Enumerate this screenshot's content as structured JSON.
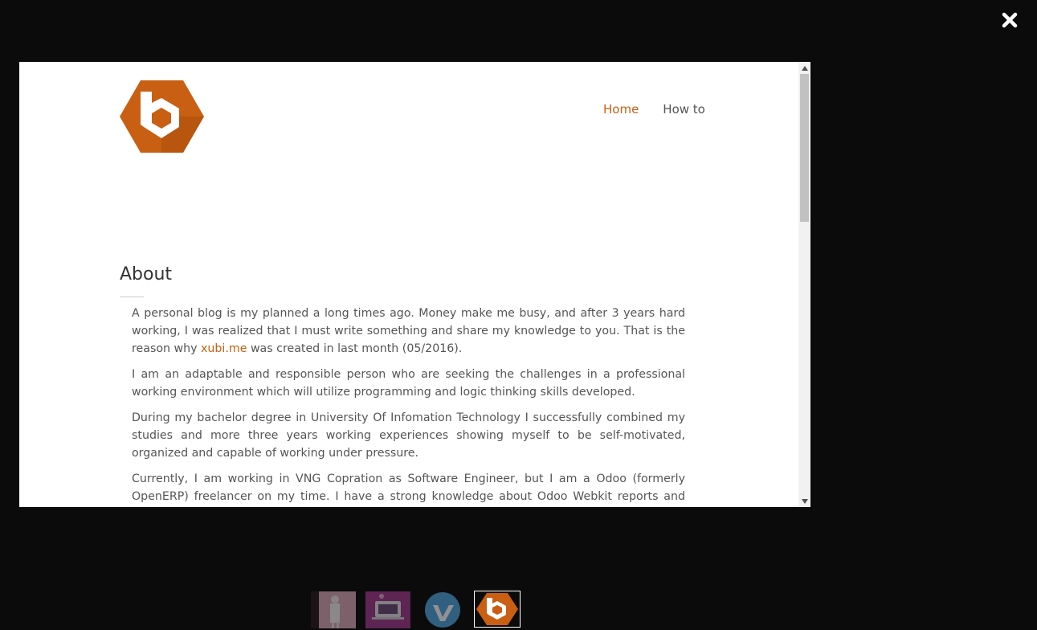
{
  "close": {
    "icon": "close-icon"
  },
  "site": {
    "logo": {
      "icon": "hexagon-b-logo-icon",
      "brand_color": "#c95f12"
    },
    "nav": [
      {
        "label": "Home",
        "active": true
      },
      {
        "label": "How to",
        "active": false
      }
    ]
  },
  "about": {
    "title": "About",
    "p1_before": "A personal blog is my planned a long times ago. Money make me busy, and after 3 years hard working, I was realized that I must write something and share my knowledge to you. That is the reason why ",
    "p1_link": "xubi.me",
    "p1_after": " was created in last month (05/2016).",
    "p2": "I am an adaptable and responsible person who are seeking the challenges in a professional working environment which will utilize programming and logic thinking skills developed.",
    "p3": "During my bachelor degree in University Of Infomation Technology I successfully combined my studies and more three years working experiences showing myself to be self-motivated, organized and capable of working under pressure.",
    "p4": "Currently, I am working in VNG Copration as Software Engineer, but I am a Odoo (formerly OpenERP) freelancer on my time. I have a strong knowledge about Odoo Webkit reports and POS module."
  },
  "thumbnails": [
    {
      "icon": "person-photo-thumbnail",
      "active": false
    },
    {
      "icon": "laptop-photo-thumbnail",
      "active": false
    },
    {
      "icon": "vimeo-logo-thumbnail",
      "active": false
    },
    {
      "icon": "hexagon-b-logo-thumbnail",
      "active": true
    }
  ]
}
